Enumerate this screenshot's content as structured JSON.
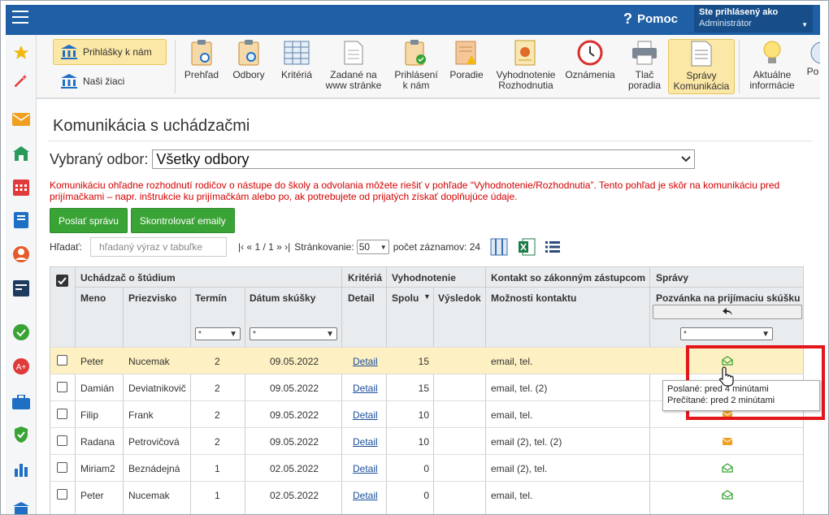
{
  "topbar": {
    "help_label": "Pomoc",
    "user_line1": "Ste prihlásený ako",
    "user_line2": "Administrátor"
  },
  "ribbon": {
    "left": {
      "applications": "Prihlášky k nám",
      "pupils": "Naši žiaci"
    },
    "items": [
      {
        "label1": "Prehľad",
        "label2": "",
        "icon": "clipboard-eye-icon"
      },
      {
        "label1": "Odbory",
        "label2": "",
        "icon": "clipboard-search-icon"
      },
      {
        "label1": "Kritériá",
        "label2": "",
        "icon": "table-icon"
      },
      {
        "label1": "Zadané na",
        "label2": "www stránke",
        "icon": "document-icon"
      },
      {
        "label1": "Prihlásení",
        "label2": "k nám",
        "icon": "clipboard-check-icon"
      },
      {
        "label1": "Poradie",
        "label2": "",
        "icon": "ranking-warning-icon"
      },
      {
        "label1": "Vyhodnotenie",
        "label2": "Rozhodnutia",
        "icon": "certificate-icon"
      },
      {
        "label1": "Oznámenia",
        "label2": "",
        "icon": "clock-icon"
      },
      {
        "label1": "Tlač",
        "label2": "poradia",
        "icon": "printer-icon"
      },
      {
        "label1": "Správy",
        "label2": "Komunikácia",
        "icon": "messages-icon"
      },
      {
        "label1": "Aktuálne",
        "label2": "informácie",
        "icon": "lightbulb-icon"
      },
      {
        "label1": "Po",
        "label2": "",
        "icon": "partial-icon"
      }
    ]
  },
  "page": {
    "title": "Komunikácia s uchádzačmi",
    "odbor_label": "Vybraný odbor:",
    "odbor_value": "Všetky odbory",
    "warning": "Komunikáciu ohľadne rozhodnutí rodičov o nástupe do školy a odvolania môžete riešiť v pohľade “Vyhodnotenie/Rozhodnutia”. Tento pohľad je skôr na komunikáciu pred prijímačkami – napr. inštrukcie ku prijímačkám alebo po, ak potrebujete od prijatých získať doplňujúce údaje.",
    "send_button": "Poslať správu",
    "check_button": "Skontrolovať emaily",
    "search_label": "Hľadať:",
    "search_placeholder": "hľadaný výraz v tabuľke",
    "pager_text": "|‹ « 1 / 1 » ›|",
    "paging_label": "Stránkovanie:",
    "paging_value": "50",
    "count_label": "počet záznamov: 24"
  },
  "table": {
    "groups": {
      "applicant": "Uchádzač o štúdium",
      "criteria": "Kritériá",
      "evaluation": "Vyhodnotenie",
      "contact": "Kontakt so zákonným zástupcom",
      "messages": "Správy"
    },
    "columns": {
      "name": "Meno",
      "surname": "Priezvisko",
      "term": "Termín",
      "date": "Dátum skúšky",
      "detail": "Detail",
      "total": "Spolu",
      "result": "Výsledok",
      "contact_options": "Možnosti kontaktu",
      "invite": "Pozvánka na prijímaciu skúšku"
    },
    "filter_value": "*",
    "rows": [
      {
        "name": "Peter",
        "surname": "Nucemak",
        "term": "2",
        "date": "09.05.2022",
        "detail": "Detail",
        "total": "15",
        "contact": "email, tel.",
        "msg": "read"
      },
      {
        "name": "Damián",
        "surname": "Deviatnikovič",
        "term": "2",
        "date": "09.05.2022",
        "detail": "Detail",
        "total": "15",
        "contact": "email, tel. (2)",
        "msg": "none"
      },
      {
        "name": "Filip",
        "surname": "Frank",
        "term": "2",
        "date": "09.05.2022",
        "detail": "Detail",
        "total": "10",
        "contact": "email, tel.",
        "msg": "sent"
      },
      {
        "name": "Radana",
        "surname": "Petrovičová",
        "term": "2",
        "date": "09.05.2022",
        "detail": "Detail",
        "total": "10",
        "contact": "email (2), tel. (2)",
        "msg": "sent"
      },
      {
        "name": "Miriam2",
        "surname": "Beznádejná",
        "term": "1",
        "date": "02.05.2022",
        "detail": "Detail",
        "total": "0",
        "contact": "email (2), tel.",
        "msg": "read"
      },
      {
        "name": "Peter",
        "surname": "Nucemak",
        "term": "1",
        "date": "02.05.2022",
        "detail": "Detail",
        "total": "0",
        "contact": "email, tel.",
        "msg": "read"
      }
    ]
  },
  "tooltip": {
    "line1": "Poslané: pred 4 minútami",
    "line2": "Prečítané: pred 2 minútami"
  },
  "colors": {
    "primary": "#1f5fa6",
    "green_button": "#3aa335",
    "highlight_row": "#fdf0c2",
    "warning_text": "#d40000",
    "callout": "#e2161b",
    "sent_icon": "#f0a020",
    "read_icon": "#3aa335"
  }
}
